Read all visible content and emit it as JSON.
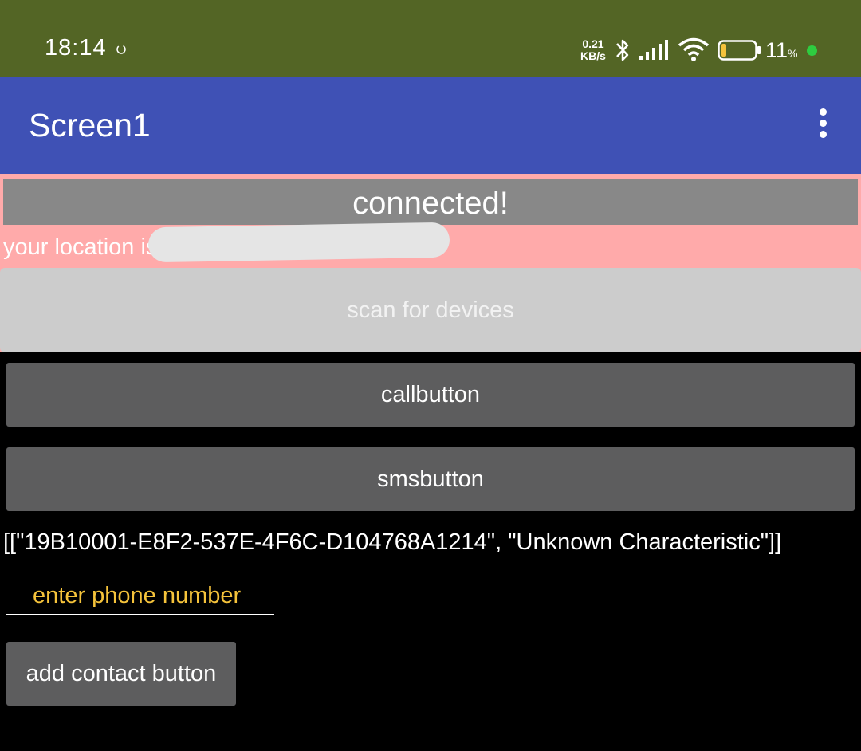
{
  "status_bar": {
    "time": "18:14",
    "network_speed_value": "0.21",
    "network_speed_unit": "KB/s",
    "battery_value": "11",
    "battery_unit": "%",
    "battery_level": 0.11,
    "background_color": "#536525",
    "charge_color": "#2ecc40",
    "icons": [
      "sync-icon",
      "bluetooth-icon",
      "signal-icon",
      "wifi-icon",
      "battery-icon"
    ]
  },
  "app_bar": {
    "title": "Screen1",
    "background_color": "#3f51b5",
    "menu_icon": "overflow-menu-icon"
  },
  "main": {
    "connection_status": "connected!",
    "location_text": "your location is",
    "scan_button_label": "scan for devices",
    "call_button_label": "callbutton",
    "sms_button_label": "smsbutton",
    "characteristics_text": "[[\"19B10001-E8F2-537E-4F6C-D104768A1214\", \"Unknown Characteristic\"]]",
    "phone_input": {
      "placeholder": "enter phone number",
      "value": ""
    },
    "add_contact_button_label": "add contact button",
    "pink_section_color": "#ffaaaa",
    "button_color": "#5d5d5e"
  }
}
